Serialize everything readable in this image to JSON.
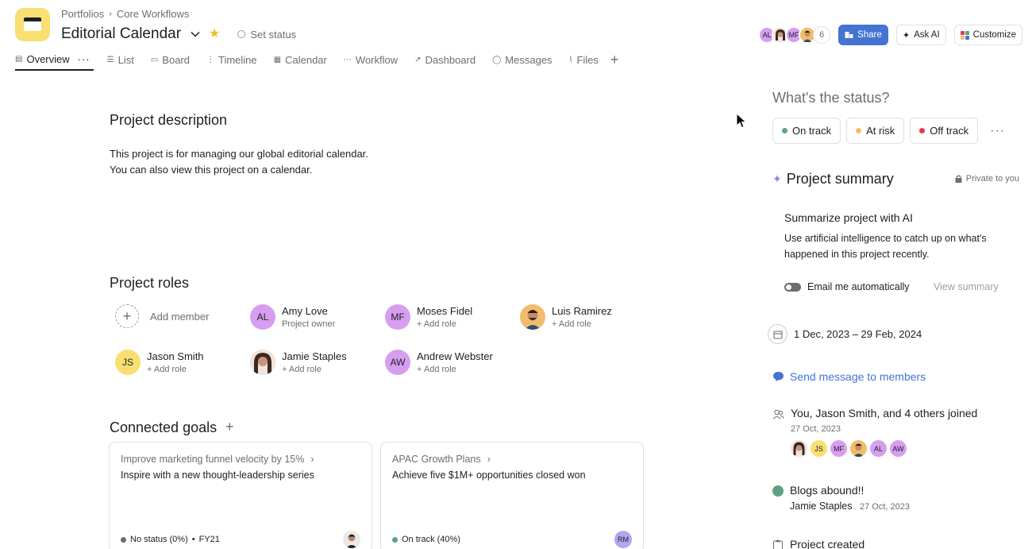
{
  "header": {
    "breadcrumb": [
      "Portfolios",
      "Core Workflows"
    ],
    "title": "Editorial Calendar",
    "set_status": "Set status",
    "member_avatars": [
      {
        "initials": "AL",
        "color": "#d79ef0"
      },
      {
        "initials": "",
        "color": "#e8c7b3"
      },
      {
        "initials": "MF",
        "color": "#d79ef0"
      },
      {
        "initials": "",
        "color": "#f1bd6c"
      }
    ],
    "member_count": "6",
    "share_label": "Share",
    "ask_ai_label": "Ask AI",
    "customize_label": "Customize"
  },
  "tabs": [
    {
      "label": "Overview",
      "icon": "overview-icon"
    },
    {
      "label": "List",
      "icon": "list-icon"
    },
    {
      "label": "Board",
      "icon": "board-icon"
    },
    {
      "label": "Timeline",
      "icon": "timeline-icon"
    },
    {
      "label": "Calendar",
      "icon": "calendar-icon"
    },
    {
      "label": "Workflow",
      "icon": "workflow-icon"
    },
    {
      "label": "Dashboard",
      "icon": "dashboard-icon"
    },
    {
      "label": "Messages",
      "icon": "messages-icon"
    },
    {
      "label": "Files",
      "icon": "files-icon"
    }
  ],
  "description": {
    "heading": "Project description",
    "line1": "This project is for managing our global editorial calendar.",
    "line2": "You can also view this project on a calendar."
  },
  "roles": {
    "heading": "Project roles",
    "add_member": "Add member",
    "members": [
      {
        "name": "Amy Love",
        "role": "Project owner",
        "initials": "AL",
        "color": "#d79ef0"
      },
      {
        "name": "Moses Fidel",
        "role": "+ Add role",
        "initials": "MF",
        "color": "#d79ef0"
      },
      {
        "name": "Luis Ramirez",
        "role": "+ Add role",
        "initials": "",
        "color": "#f1bd6c"
      },
      {
        "name": "Jason Smith",
        "role": "+ Add role",
        "initials": "JS",
        "color": "#f8df72"
      },
      {
        "name": "Jamie Staples",
        "role": "+ Add role",
        "initials": "",
        "color": "#e8c7b3"
      },
      {
        "name": "Andrew Webster",
        "role": "+ Add role",
        "initials": "AW",
        "color": "#d79ef0"
      }
    ]
  },
  "goals": {
    "heading": "Connected goals",
    "cards": [
      {
        "parent": "Improve marketing funnel velocity by 15%",
        "title": "Inspire with a new thought-leadership series",
        "status": "No status (0%)",
        "period": "FY21",
        "status_color": "#6d6e6f",
        "owner_initials": ""
      },
      {
        "parent": "APAC Growth Plans",
        "title": "Achieve five $1M+ opportunities closed won",
        "status": "On track (40%)",
        "period": "",
        "status_color": "#5da283",
        "owner_initials": "RM"
      }
    ]
  },
  "status_panel": {
    "question": "What's the status?",
    "options": [
      {
        "label": "On track",
        "color": "#5da283"
      },
      {
        "label": "At risk",
        "color": "#f1bd6c"
      },
      {
        "label": "Off track",
        "color": "#e8384f"
      }
    ]
  },
  "summary": {
    "heading": "Project summary",
    "private": "Private to you",
    "ai_title": "Summarize project with AI",
    "ai_desc": "Use artificial intelligence to catch up on what's happened in this project recently.",
    "email_label": "Email me automatically",
    "view_summary": "View summary"
  },
  "date_range": "1 Dec, 2023 – 29 Feb, 2024",
  "send_message": "Send message to members",
  "activity": {
    "joined_title": "You, Jason Smith, and 4 others joined",
    "joined_date": "27 Oct, 2023",
    "joined_avatars": [
      {
        "initials": "",
        "color": "#e8c7b3"
      },
      {
        "initials": "JS",
        "color": "#f8df72"
      },
      {
        "initials": "MF",
        "color": "#d79ef0"
      },
      {
        "initials": "",
        "color": "#f1bd6c"
      },
      {
        "initials": "AL",
        "color": "#d79ef0"
      },
      {
        "initials": "AW",
        "color": "#d79ef0"
      }
    ],
    "blog_title": "Blogs abound!!",
    "blog_author": "Jamie Staples",
    "blog_date": "27 Oct, 2023",
    "created_title": "Project created"
  }
}
